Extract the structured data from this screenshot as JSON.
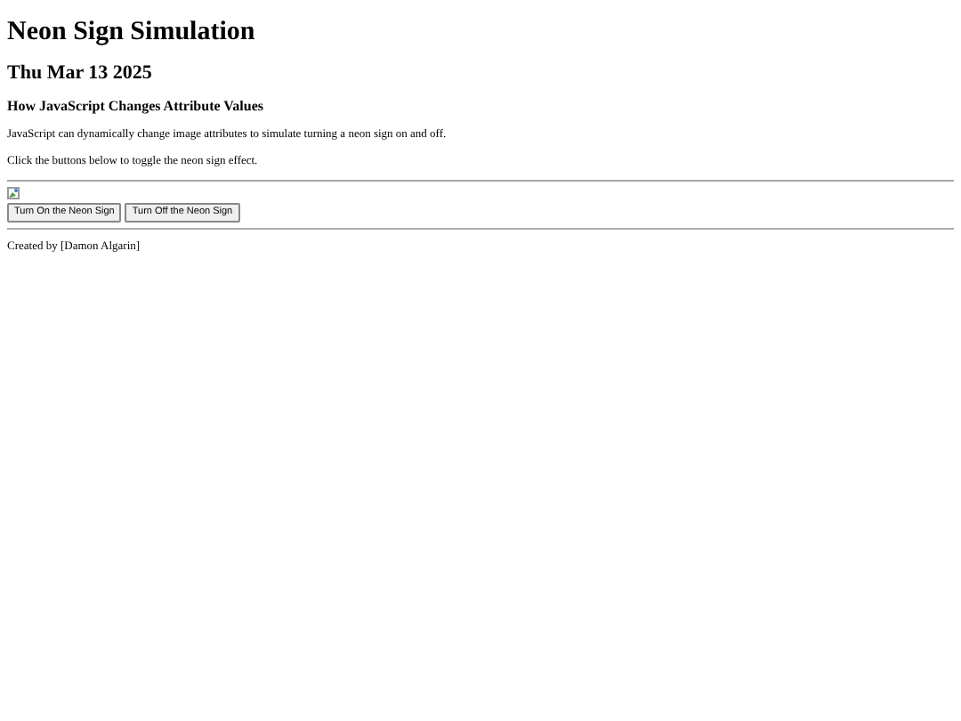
{
  "title": "Neon Sign Simulation",
  "date": "Thu Mar 13 2025",
  "subtitle": "How JavaScript Changes Attribute Values",
  "paragraphs": [
    "JavaScript can dynamically change image attributes to simulate turning a neon sign on and off.",
    "Click the buttons below to toggle the neon sign effect."
  ],
  "buttons": [
    "Turn On the Neon Sign",
    "Turn Off the Neon Sign"
  ],
  "footer": "Created by [Damon Algarin]"
}
